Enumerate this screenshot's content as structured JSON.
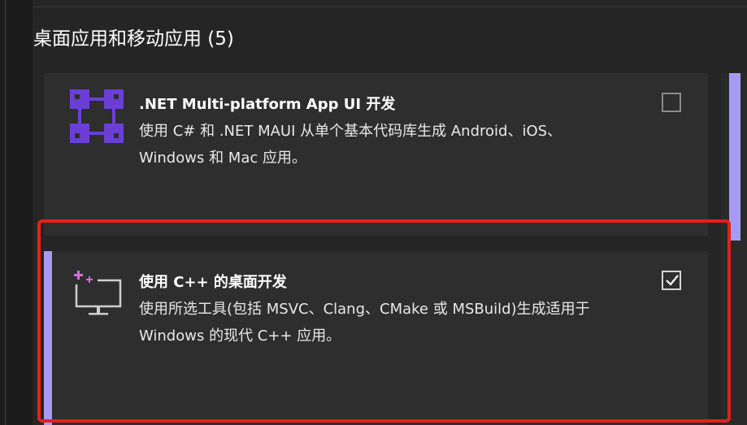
{
  "section": {
    "title": "桌面应用和移动应用 (5)"
  },
  "workloads": [
    {
      "title": ".NET Multi-platform App UI 开发",
      "description": "使用 C# 和 .NET MAUI 从单个基本代码库生成 Android、iOS、Windows 和 Mac 应用。",
      "checked": false,
      "icon": "maui-grid-icon"
    },
    {
      "title": "使用 C++ 的桌面开发",
      "description": "使用所选工具(包括 MSVC、Clang、CMake 或 MSBuild)生成适用于 Windows 的现代 C++ 应用。",
      "checked": true,
      "icon": "desktop-monitor-icon"
    }
  ],
  "colors": {
    "accent": "#a59bf5",
    "maui_icon": "#6b3fd6",
    "selection_outline": "#e5201c"
  }
}
